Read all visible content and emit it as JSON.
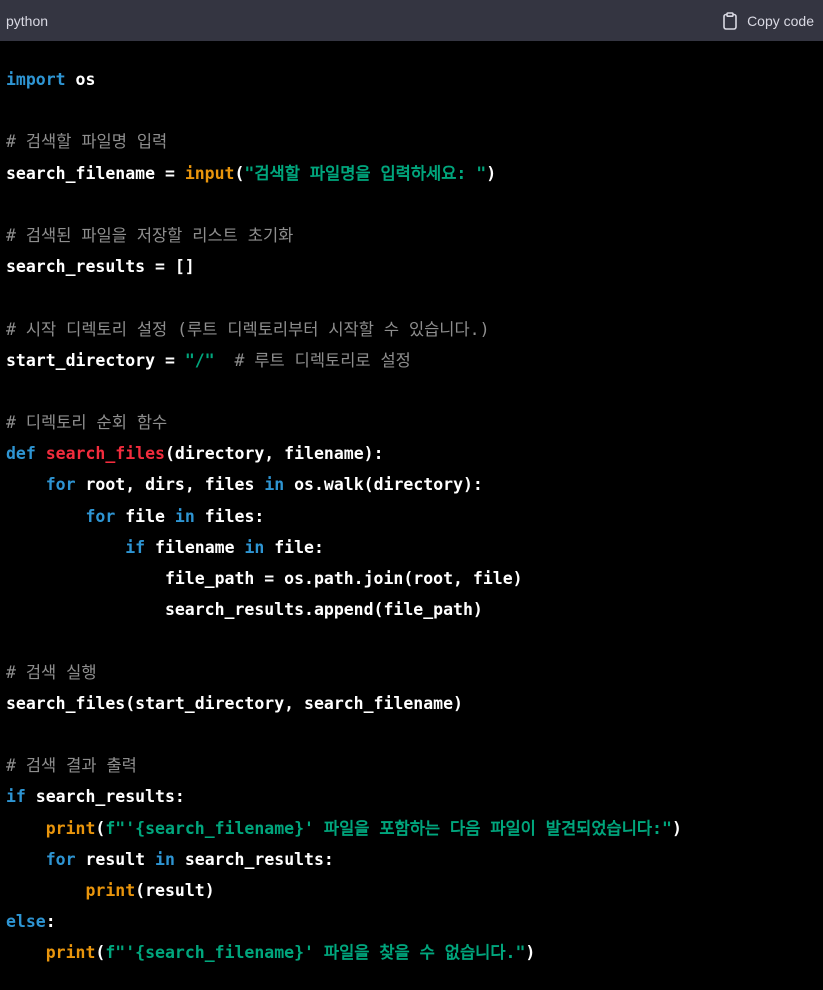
{
  "header": {
    "language": "python",
    "copy_label": "Copy code"
  },
  "colors": {
    "header_bg": "#343541",
    "code_bg": "#000000",
    "keyword": "#2e95d3",
    "function_name": "#f22c3d",
    "builtin": "#e9950c",
    "string": "#00a67d",
    "comment": "#8e8e8e",
    "text": "#ffffff"
  },
  "code_lines": [
    [
      {
        "t": "kw",
        "v": "import"
      },
      {
        "t": "tx",
        "v": " os"
      }
    ],
    [],
    [
      {
        "t": "cm",
        "v": "# 검색할 파일명 입력"
      }
    ],
    [
      {
        "t": "tx",
        "v": "search_filename = "
      },
      {
        "t": "bi",
        "v": "input"
      },
      {
        "t": "tx",
        "v": "("
      },
      {
        "t": "st",
        "v": "\"검색할 파일명을 입력하세요: \""
      },
      {
        "t": "tx",
        "v": ")"
      }
    ],
    [],
    [
      {
        "t": "cm",
        "v": "# 검색된 파일을 저장할 리스트 초기화"
      }
    ],
    [
      {
        "t": "tx",
        "v": "search_results = []"
      }
    ],
    [],
    [
      {
        "t": "cm",
        "v": "# 시작 디렉토리 설정 (루트 디렉토리부터 시작할 수 있습니다.)"
      }
    ],
    [
      {
        "t": "tx",
        "v": "start_directory = "
      },
      {
        "t": "st",
        "v": "\"/\""
      },
      {
        "t": "tx",
        "v": "  "
      },
      {
        "t": "cm",
        "v": "# 루트 디렉토리로 설정"
      }
    ],
    [],
    [
      {
        "t": "cm",
        "v": "# 디렉토리 순회 함수"
      }
    ],
    [
      {
        "t": "kw",
        "v": "def"
      },
      {
        "t": "tx",
        "v": " "
      },
      {
        "t": "fn",
        "v": "search_files"
      },
      {
        "t": "tx",
        "v": "(directory, filename):"
      }
    ],
    [
      {
        "t": "tx",
        "v": "    "
      },
      {
        "t": "kw",
        "v": "for"
      },
      {
        "t": "tx",
        "v": " root, dirs, files "
      },
      {
        "t": "kw",
        "v": "in"
      },
      {
        "t": "tx",
        "v": " os.walk(directory):"
      }
    ],
    [
      {
        "t": "tx",
        "v": "        "
      },
      {
        "t": "kw",
        "v": "for"
      },
      {
        "t": "tx",
        "v": " file "
      },
      {
        "t": "kw",
        "v": "in"
      },
      {
        "t": "tx",
        "v": " files:"
      }
    ],
    [
      {
        "t": "tx",
        "v": "            "
      },
      {
        "t": "kw",
        "v": "if"
      },
      {
        "t": "tx",
        "v": " filename "
      },
      {
        "t": "kw",
        "v": "in"
      },
      {
        "t": "tx",
        "v": " file:"
      }
    ],
    [
      {
        "t": "tx",
        "v": "                file_path = os.path.join(root, file)"
      }
    ],
    [
      {
        "t": "tx",
        "v": "                search_results.append(file_path)"
      }
    ],
    [],
    [
      {
        "t": "cm",
        "v": "# 검색 실행"
      }
    ],
    [
      {
        "t": "tx",
        "v": "search_files(start_directory, search_filename)"
      }
    ],
    [],
    [
      {
        "t": "cm",
        "v": "# 검색 결과 출력"
      }
    ],
    [
      {
        "t": "kw",
        "v": "if"
      },
      {
        "t": "tx",
        "v": " search_results:"
      }
    ],
    [
      {
        "t": "tx",
        "v": "    "
      },
      {
        "t": "bi",
        "v": "print"
      },
      {
        "t": "tx",
        "v": "("
      },
      {
        "t": "st",
        "v": "f\"'{search_filename}' 파일을 포함하는 다음 파일이 발견되었습니다:\""
      },
      {
        "t": "tx",
        "v": ")"
      }
    ],
    [
      {
        "t": "tx",
        "v": "    "
      },
      {
        "t": "kw",
        "v": "for"
      },
      {
        "t": "tx",
        "v": " result "
      },
      {
        "t": "kw",
        "v": "in"
      },
      {
        "t": "tx",
        "v": " search_results:"
      }
    ],
    [
      {
        "t": "tx",
        "v": "        "
      },
      {
        "t": "bi",
        "v": "print"
      },
      {
        "t": "tx",
        "v": "(result)"
      }
    ],
    [
      {
        "t": "kw",
        "v": "else"
      },
      {
        "t": "tx",
        "v": ":"
      }
    ],
    [
      {
        "t": "tx",
        "v": "    "
      },
      {
        "t": "bi",
        "v": "print"
      },
      {
        "t": "tx",
        "v": "("
      },
      {
        "t": "st",
        "v": "f\"'{search_filename}' 파일을 찾을 수 없습니다.\""
      },
      {
        "t": "tx",
        "v": ")"
      }
    ]
  ]
}
